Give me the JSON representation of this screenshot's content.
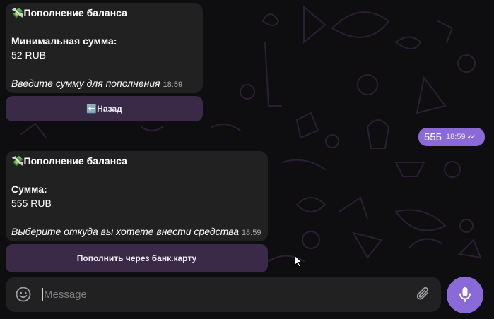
{
  "messages": [
    {
      "emoji": "💸",
      "title": "Пополнение баланса",
      "label": "Минимальная сумма:",
      "value": "52 RUB",
      "prompt": "Введите сумму для пополнения",
      "time": "18:59",
      "button": {
        "icon": "⬅️",
        "label": "Назад"
      }
    },
    {
      "emoji": "💸",
      "title": "Пополнение баланса",
      "label": "Сумма:",
      "value": "555 RUB",
      "prompt": "Выберите откуда вы хотете внести средства",
      "time": "18:59",
      "button": {
        "label": "Пополнить через банк.карту"
      }
    }
  ],
  "outgoing": {
    "text": "555",
    "time": "18:59",
    "status": "✓✓"
  },
  "composer": {
    "placeholder": "Message"
  },
  "icons": {
    "emoji_button": "smiley-icon",
    "attach": "paperclip-icon",
    "mic": "microphone-icon",
    "read_status": "double-check-icon"
  },
  "colors": {
    "background": "#0e0e10",
    "bubble": "#212121",
    "keyboard_button": "#3a2a48",
    "outgoing_bubble": "#8b6ad8",
    "accent": "#8a6ad8"
  }
}
